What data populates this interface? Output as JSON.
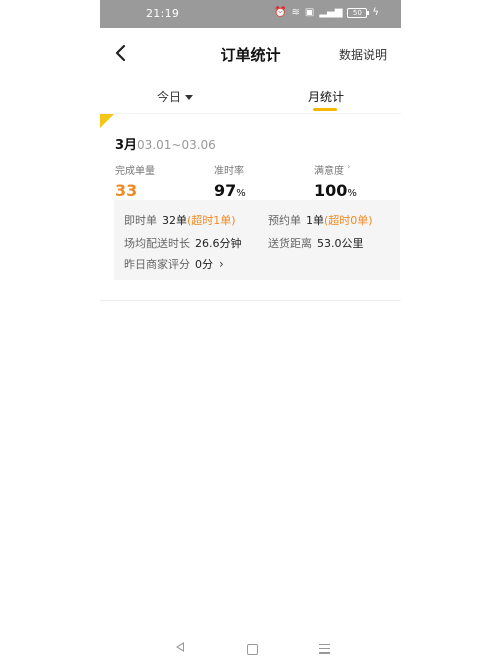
{
  "status_bar": {
    "time": "21:19",
    "battery": "50"
  },
  "nav": {
    "title": "订单统计",
    "help": "数据说明"
  },
  "tabs": [
    {
      "label": "今日",
      "selected": false
    },
    {
      "label": "月统计",
      "selected": true
    }
  ],
  "card": {
    "month": "3月",
    "range": "03.01~03.06",
    "metrics": [
      {
        "label": "完成单量",
        "value": "33",
        "unit": ""
      },
      {
        "label": "准时率",
        "value": "97",
        "unit": "%"
      },
      {
        "label": "满意度",
        "value": "100",
        "unit": "%",
        "info": "›"
      }
    ],
    "details": {
      "instant_label": "即时单",
      "instant_value": "32单",
      "instant_note": "(超时1单)",
      "booked_label": "预约单",
      "booked_value": "1单",
      "booked_note": "(超时0单)",
      "avg_time_label": "场均配送时长",
      "avg_time_value": "26.6分钟",
      "distance_label": "送货距离",
      "distance_value": "53.0公里",
      "rating_label": "昨日商家评分",
      "rating_value": "0分"
    }
  },
  "colors": {
    "accent": "#f5b700",
    "orange": "#f08a24",
    "status_bar": "#9a9a9a"
  }
}
